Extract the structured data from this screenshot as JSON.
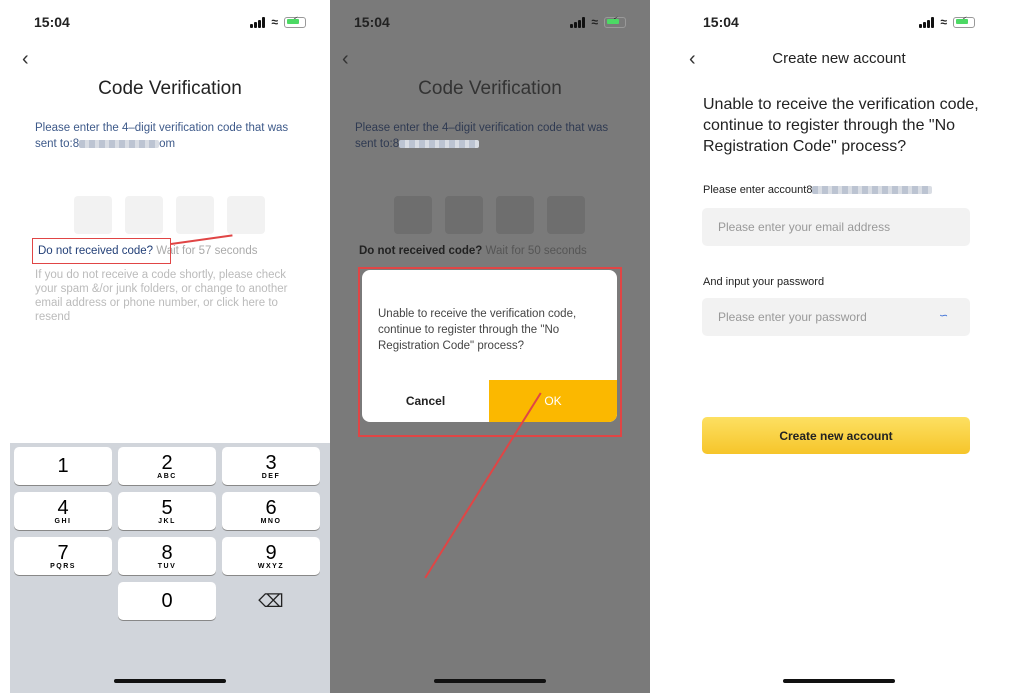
{
  "status": {
    "time": "15:04"
  },
  "screen1": {
    "title": "Code Verification",
    "desc_prefix": "Please enter the 4–digit verification code that was sent to:8",
    "desc_suffix": "om",
    "resend_link": "Do not received code?",
    "wait_text": " Wait for 57 seconds",
    "hint": "If you do not receive a code shortly, please check your spam &/or junk folders, or change to another email address or phone number, or click here to resend",
    "keys": [
      {
        "n": "1",
        "l": ""
      },
      {
        "n": "2",
        "l": "ABC"
      },
      {
        "n": "3",
        "l": "DEF"
      },
      {
        "n": "4",
        "l": "GHI"
      },
      {
        "n": "5",
        "l": "JKL"
      },
      {
        "n": "6",
        "l": "MNO"
      },
      {
        "n": "7",
        "l": "PQRS"
      },
      {
        "n": "8",
        "l": "TUV"
      },
      {
        "n": "9",
        "l": "WXYZ"
      },
      {
        "n": "0",
        "l": ""
      }
    ]
  },
  "screen2": {
    "title": "Code Verification",
    "desc_prefix": "Please enter the 4–digit verification code that was sent to:8",
    "resend_link": "Do not received code?",
    "wait_text": " Wait for 50 seconds",
    "dialog_message": "Unable to receive the verification code, continue to register through the \"No Registration Code\" process?",
    "cancel_label": "Cancel",
    "ok_label": "OK"
  },
  "screen3": {
    "nav_title": "Create new account",
    "message": "Unable to receive the verification code, continue to register through the \"No Registration Code\" process?",
    "account_label": "Please enter account8",
    "email_placeholder": "Please enter your email address",
    "password_label": "And input your password",
    "password_placeholder": "Please enter your password",
    "create_label": "Create new account"
  },
  "colors": {
    "accent": "#fbb800",
    "annotation": "#e04545"
  }
}
